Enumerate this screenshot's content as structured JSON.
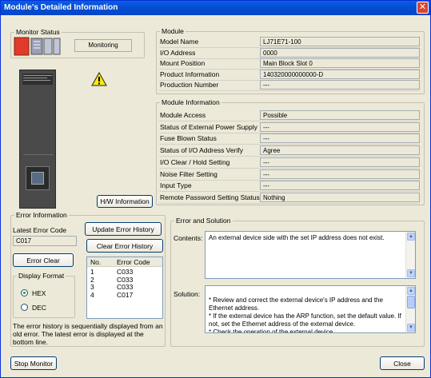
{
  "window": {
    "title": "Module's Detailed Information",
    "close_glyph": "✕"
  },
  "monitor": {
    "legend": "Monitor Status",
    "state": "Monitoring"
  },
  "module": {
    "legend": "Module",
    "rows": [
      {
        "label": "Model Name",
        "value": "LJ71E71-100"
      },
      {
        "label": "I/O Address",
        "value": "0000"
      },
      {
        "label": "Mount Position",
        "value": "Main Block Slot 0"
      },
      {
        "label": "Product Information",
        "value": "140320000000000-D"
      },
      {
        "label": "Production Number",
        "value": "---"
      }
    ]
  },
  "module_info": {
    "legend": "Module Information",
    "rows": [
      {
        "label": "Module Access",
        "value": "Possible"
      },
      {
        "label": "Status of External Power Supply",
        "value": "---"
      },
      {
        "label": "Fuse Blown Status",
        "value": "---"
      },
      {
        "label": "Status of I/O Address Verify",
        "value": "Agree"
      },
      {
        "label": "I/O Clear / Hold Setting",
        "value": "---"
      },
      {
        "label": "Noise Filter Setting",
        "value": "---"
      },
      {
        "label": "Input Type",
        "value": "---"
      },
      {
        "label": "Remote Password Setting Status",
        "value": "Nothing"
      }
    ]
  },
  "hw_button": "H/W Information",
  "error_info": {
    "legend": "Error Information",
    "latest_label": "Latest Error Code",
    "latest_value": "C017",
    "update_history": "Update Error History",
    "clear_history": "Clear Error History",
    "error_clear": "Error Clear",
    "display_format": "Display Format",
    "hex": "HEX",
    "dec": "DEC",
    "history_headers": {
      "no": "No.",
      "code": "Error Code"
    },
    "history": [
      {
        "no": "1",
        "code": "C033"
      },
      {
        "no": "2",
        "code": "C033"
      },
      {
        "no": "3",
        "code": "C033"
      },
      {
        "no": "4",
        "code": "C017"
      }
    ],
    "note": "The error history is sequentially displayed from an old error. The latest error is displayed at the bottom line."
  },
  "error_solution": {
    "legend": "Error and Solution",
    "contents_label": "Contents:",
    "contents_text": "An external device side with the set IP address does not exist.",
    "solution_label": "Solution:",
    "solution_text": "* Review and correct the external device's IP address and the Ethernet address.\n* If the external device has the ARP function, set the default value. If not, set the Ethernet address of the external device.\n* Check the operation of the external device."
  },
  "footer": {
    "stop_monitor": "Stop Monitor",
    "close": "Close"
  },
  "colors": {
    "title_bar": "#0550d6",
    "window_bg": "#ece9d8",
    "status_icon": "#e03b2a"
  }
}
